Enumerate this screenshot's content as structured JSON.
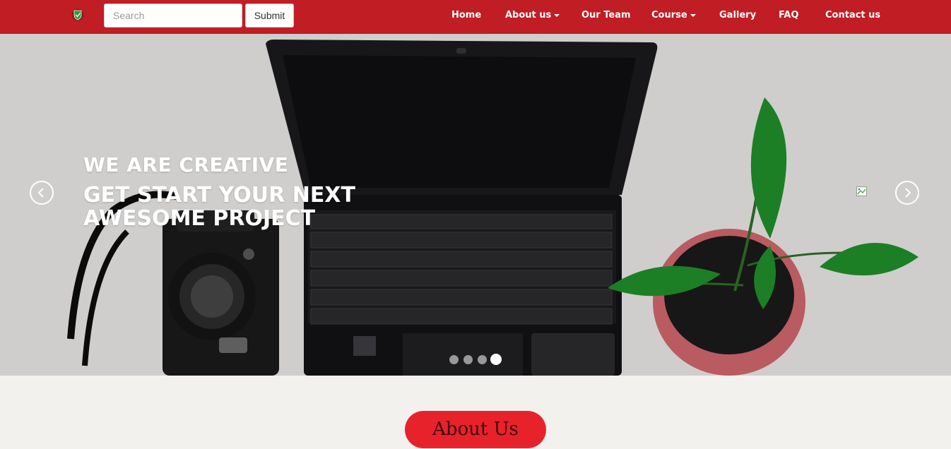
{
  "navbar": {
    "logo_icon": "shield-logo-icon",
    "search": {
      "placeholder": "Search",
      "value": ""
    },
    "submit_label": "Submit",
    "items": [
      {
        "label": "Home",
        "dropdown": false
      },
      {
        "label": "About us",
        "dropdown": true
      },
      {
        "label": "Our Team",
        "dropdown": false
      },
      {
        "label": "Course",
        "dropdown": true
      },
      {
        "label": "Gallery",
        "dropdown": false
      },
      {
        "label": "FAQ",
        "dropdown": false
      },
      {
        "label": "Contact us",
        "dropdown": false
      }
    ],
    "background": "#c01d24"
  },
  "hero": {
    "subtitle": "WE ARE CREATIVE",
    "title": "GET START YOUR NEXT AWESOME PROJECT",
    "prev_icon": "chevron-left-icon",
    "next_icon": "chevron-right-icon",
    "slide_count": 4,
    "active_slide": 4
  },
  "about": {
    "button_label": "About Us",
    "accent": "#e8222b"
  }
}
